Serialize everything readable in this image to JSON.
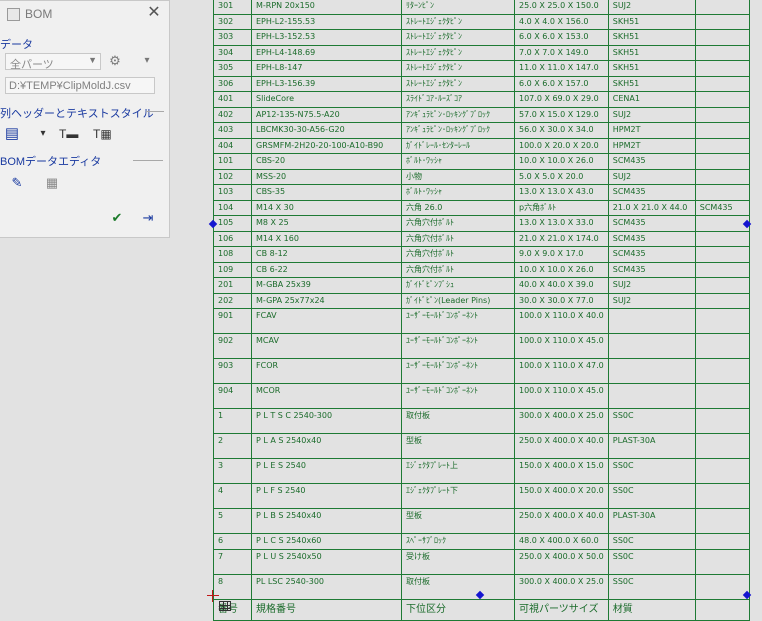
{
  "panel": {
    "title": "BOM",
    "section_data": "データ",
    "parts_select": "全パーツ",
    "file_path": "D:¥TEMP¥ClipMoldJ.csv",
    "section_header_style": "列ヘッダーとテキストスタイル",
    "section_bom_editor": "BOMデータエディタ",
    "icons": {
      "gear": "⚙",
      "dropdown": "▾",
      "edit": "✎",
      "grid": "▦",
      "check": "✔",
      "exit": "⇥",
      "close": "✕"
    }
  },
  "table": {
    "header": [
      "番号",
      "規格番号",
      "下位区分",
      "可視パーツサイズ",
      "材質",
      ""
    ],
    "rows": [
      {
        "h": 1,
        "c": [
          "301",
          "M-RPN 20x150",
          "ﾘﾀｰﾝﾋﾟﾝ",
          "25.0 X 25.0 X 150.0",
          "SUJ2",
          ""
        ]
      },
      {
        "h": 1,
        "c": [
          "302",
          "EPH-L2-155.53",
          "ｽﾄﾚｰﾄｴｼﾞｪｸﾀﾋﾟﾝ",
          "4.0 X 4.0 X 156.0",
          "SKH51",
          ""
        ]
      },
      {
        "h": 1,
        "c": [
          "303",
          "EPH-L3-152.53",
          "ｽﾄﾚｰﾄｴｼﾞｪｸﾀﾋﾟﾝ",
          "6.0 X 6.0 X 153.0",
          "SKH51",
          ""
        ]
      },
      {
        "h": 1,
        "c": [
          "304",
          "EPH-L4-148.69",
          "ｽﾄﾚｰﾄｴｼﾞｪｸﾀﾋﾟﾝ",
          "7.0 X 7.0 X 149.0",
          "SKH51",
          ""
        ]
      },
      {
        "h": 1,
        "c": [
          "305",
          "EPH-L8-147",
          "ｽﾄﾚｰﾄｴｼﾞｪｸﾀﾋﾟﾝ",
          "11.0 X 11.0 X 147.0",
          "SKH51",
          ""
        ]
      },
      {
        "h": 1,
        "c": [
          "306",
          "EPH-L3-156.39",
          "ｽﾄﾚｰﾄｴｼﾞｪｸﾀﾋﾟﾝ",
          "6.0 X 6.0 X 157.0",
          "SKH51",
          ""
        ]
      },
      {
        "h": 1,
        "c": [
          "401",
          "SlideCore",
          "ｽﾗｲﾄﾞｺｱ･ﾙｰｽﾞｺｱ",
          "107.0 X 69.0 X 29.0",
          "CENA1",
          ""
        ]
      },
      {
        "h": 1,
        "c": [
          "402",
          "AP12-135-N75.5-A20",
          "ｱﾝｷﾞｭﾗﾋﾟﾝ･ﾛｯｷﾝｸﾞﾌﾞﾛｯｸ",
          "57.0 X 15.0 X 129.0",
          "SUJ2",
          ""
        ]
      },
      {
        "h": 1,
        "c": [
          "403",
          "LBCMK30-30-A56-G20",
          "ｱﾝｷﾞｭﾗﾋﾟﾝ･ﾛｯｷﾝｸﾞﾌﾞﾛｯｸ",
          "56.0 X 30.0 X 34.0",
          "HPM2T",
          ""
        ]
      },
      {
        "h": 1,
        "c": [
          "404",
          "GRSMFM-2H20-20-100-A10-B90",
          "ｶﾞｲﾄﾞﾚｰﾙ･ｾﾝﾀｰﾚｰﾙ",
          "100.0 X 20.0 X 20.0",
          "HPM2T",
          ""
        ]
      },
      {
        "h": 1,
        "c": [
          "101",
          "CBS-20",
          "ﾎﾞﾙﾄ･ﾜｯｼｬ",
          "10.0 X 10.0 X 26.0",
          "SCM435",
          ""
        ]
      },
      {
        "h": 1,
        "c": [
          "102",
          "MSS-20",
          "小物",
          "5.0 X 5.0 X 20.0",
          "SUJ2",
          ""
        ]
      },
      {
        "h": 1,
        "c": [
          "103",
          "CBS-35",
          "ﾎﾞﾙﾄ･ﾜｯｼｬ",
          "13.0 X 13.0 X 43.0",
          "SCM435",
          ""
        ]
      },
      {
        "h": 1,
        "c": [
          "104",
          "M14 X 30",
          "六角 26.0",
          "p六角ﾎﾞﾙﾄ",
          "21.0 X 21.0 X 44.0",
          "SCM435"
        ]
      },
      {
        "h": 1,
        "c": [
          "105",
          "M8 X 25",
          "六角穴付ﾎﾞﾙﾄ",
          "13.0 X 13.0 X 33.0",
          "SCM435",
          ""
        ]
      },
      {
        "h": 1,
        "c": [
          "106",
          "M14 X 160",
          "六角穴付ﾎﾞﾙﾄ",
          "21.0 X 21.0 X 174.0",
          "SCM435",
          ""
        ]
      },
      {
        "h": 1,
        "c": [
          "108",
          "CB 8-12",
          "六角穴付ﾎﾞﾙﾄ",
          "9.0 X 9.0 X 17.0",
          "SCM435",
          ""
        ]
      },
      {
        "h": 1,
        "c": [
          "109",
          "CB 6-22",
          "六角穴付ﾎﾞﾙﾄ",
          "10.0 X 10.0 X 26.0",
          "SCM435",
          ""
        ]
      },
      {
        "h": 1,
        "c": [
          "201",
          "M-GBA 25x39",
          "ｶﾞｲﾄﾞﾋﾟﾝﾌﾞｼｭ",
          "40.0 X 40.0 X 39.0",
          "SUJ2",
          ""
        ]
      },
      {
        "h": 1,
        "c": [
          "202",
          "M-GPA 25x77x24",
          "ｶﾞｲﾄﾞﾋﾟﾝ(Leader Pins)",
          "30.0 X 30.0 X 77.0",
          "SUJ2",
          ""
        ]
      },
      {
        "h": 2,
        "c": [
          "901",
          "FCAV",
          "ﾕｰｻﾞｰﾓｰﾙﾄﾞｺﾝﾎﾟｰﾈﾝﾄ",
          "100.0 X 110.0 X 40.0",
          "",
          ""
        ]
      },
      {
        "h": 2,
        "c": [
          "902",
          "MCAV",
          "ﾕｰｻﾞｰﾓｰﾙﾄﾞｺﾝﾎﾟｰﾈﾝﾄ",
          "100.0 X 110.0 X 45.0",
          "",
          ""
        ]
      },
      {
        "h": 2,
        "c": [
          "903",
          "FCOR",
          "ﾕｰｻﾞｰﾓｰﾙﾄﾞｺﾝﾎﾟｰﾈﾝﾄ",
          "100.0 X 110.0 X 47.0",
          "",
          ""
        ]
      },
      {
        "h": 2,
        "c": [
          "904",
          "MCOR",
          "ﾕｰｻﾞｰﾓｰﾙﾄﾞｺﾝﾎﾟｰﾈﾝﾄ",
          "100.0 X 110.0 X 45.0",
          "",
          ""
        ]
      },
      {
        "h": 2,
        "c": [
          "1",
          "P L T S C 2540-300",
          "取付板",
          "300.0 X 400.0 X 25.0",
          "SS0C",
          ""
        ]
      },
      {
        "h": 2,
        "c": [
          "2",
          "P L A S 2540x40",
          "型板",
          "250.0 X 400.0 X 40.0",
          "PLAST-30A",
          ""
        ]
      },
      {
        "h": 2,
        "c": [
          "3",
          "P L E S 2540",
          "ｴｼﾞｪｸﾀﾌﾟﾚｰﾄ上",
          "150.0 X 400.0 X 15.0",
          "SS0C",
          ""
        ]
      },
      {
        "h": 2,
        "c": [
          "4",
          "P L F S 2540",
          "ｴｼﾞｪｸﾀﾌﾟﾚｰﾄ下",
          "150.0 X 400.0 X 20.0",
          "SS0C",
          ""
        ]
      },
      {
        "h": 2,
        "c": [
          "5",
          "P L B S 2540x40",
          "型板",
          "250.0 X 400.0 X 40.0",
          "PLAST-30A",
          ""
        ]
      },
      {
        "h": 1,
        "c": [
          "6",
          "P L C S 2540x60",
          "ｽﾍﾟｰｻﾌﾞﾛｯｸ",
          "48.0 X 400.0 X 60.0",
          "SS0C",
          ""
        ]
      },
      {
        "h": 2,
        "c": [
          "7",
          "P L U S 2540x50",
          "受け板",
          "250.0 X 400.0 X 50.0",
          "SS0C",
          ""
        ]
      },
      {
        "h": 2,
        "c": [
          "8",
          "PL LSC 2540-300",
          "取付板",
          "300.0 X 400.0 X 25.0",
          "SS0C",
          ""
        ]
      }
    ]
  },
  "colors": {
    "line": "#1e7a34",
    "text": "#1a6b2a",
    "handle": "#1515d0",
    "background": "#e2e2e2"
  }
}
